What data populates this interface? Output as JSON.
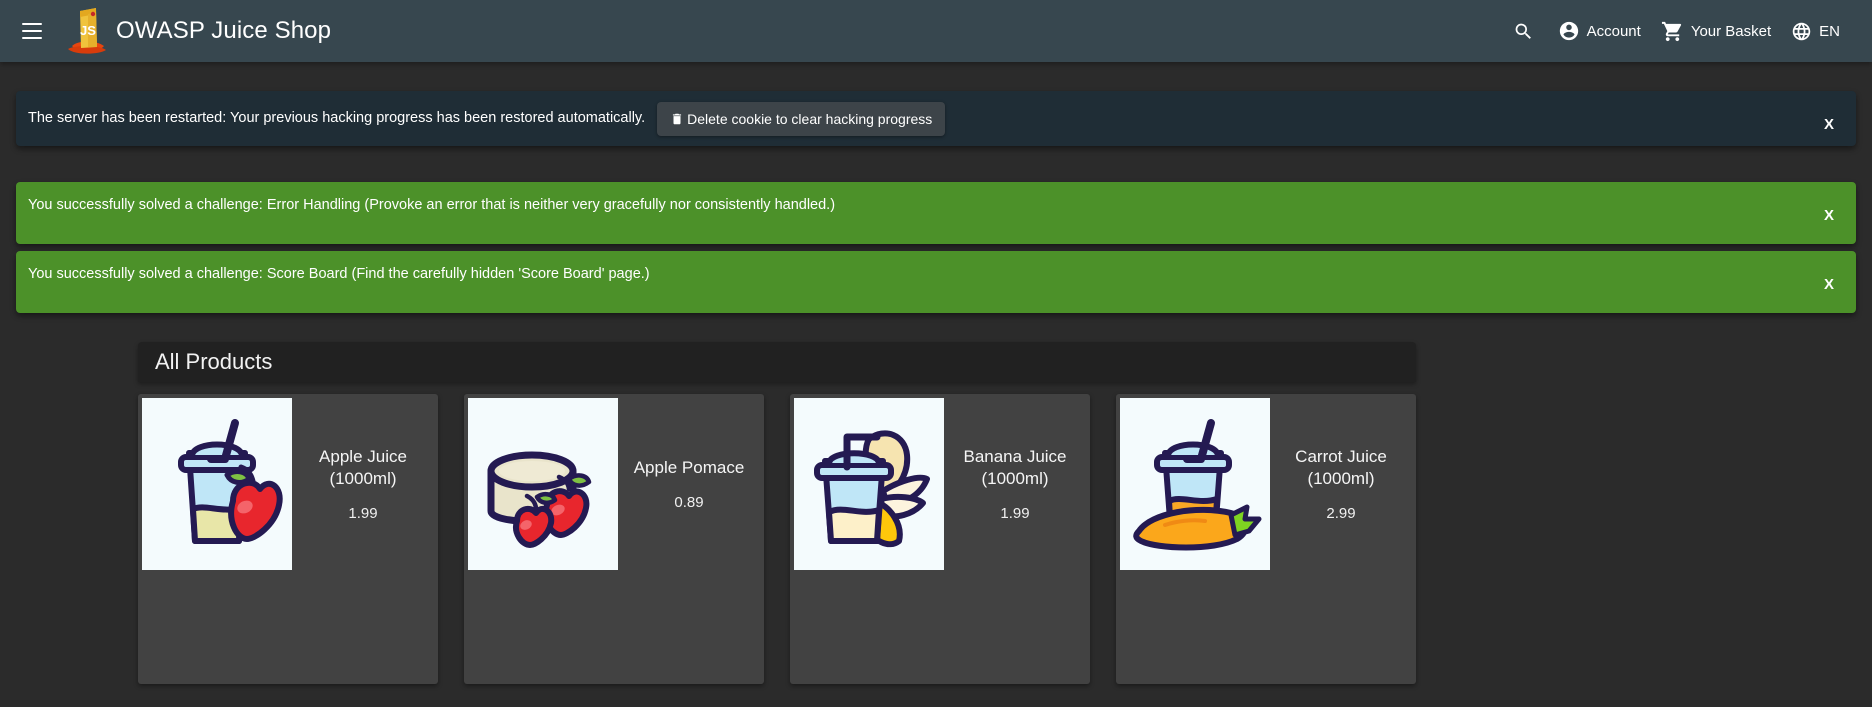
{
  "toolbar": {
    "menu_icon": "hamburger-menu-icon",
    "logo_icon": "juice-shop-logo-icon",
    "title": "OWASP Juice Shop",
    "search_icon": "search-icon",
    "account_icon": "account-circle-icon",
    "account_label": "Account",
    "basket_icon": "shopping-cart-icon",
    "basket_label": "Your Basket",
    "language_icon": "globe-icon",
    "language_label": "EN",
    "background_color": "#37474f"
  },
  "banners": {
    "restart": {
      "text": "The server has been restarted: Your previous hacking progress has been restored automatically.",
      "button_label": "Delete cookie to clear hacking progress",
      "button_icon": "trash-icon",
      "close_label": "X",
      "background_color": "#1f2d36"
    },
    "success": [
      {
        "text": "You successfully solved a challenge: Error Handling (Provoke an error that is neither very gracefully nor consistently handled.)",
        "close_label": "X",
        "background_color": "#4c9129"
      },
      {
        "text": "You successfully solved a challenge: Score Board (Find the carefully hidden 'Score Board' page.)",
        "close_label": "X",
        "background_color": "#4c9129"
      }
    ]
  },
  "products": {
    "header_title": "All Products",
    "items": [
      {
        "name_line1": "Apple Juice",
        "name_line2": "(1000ml)",
        "price": "1.99",
        "image_icon": "apple-juice-cup-icon"
      },
      {
        "name_line1": "Apple Pomace",
        "name_line2": "",
        "price": "0.89",
        "image_icon": "apple-pomace-icon"
      },
      {
        "name_line1": "Banana Juice",
        "name_line2": "(1000ml)",
        "price": "1.99",
        "image_icon": "banana-juice-cup-icon"
      },
      {
        "name_line1": "Carrot Juice",
        "name_line2": "(1000ml)",
        "price": "2.99",
        "image_icon": "carrot-juice-cup-icon"
      }
    ]
  },
  "colors": {
    "page_background": "#2b2b2b",
    "card_background": "#424242",
    "panel_background": "#212121",
    "accent_green": "#4c9129"
  }
}
